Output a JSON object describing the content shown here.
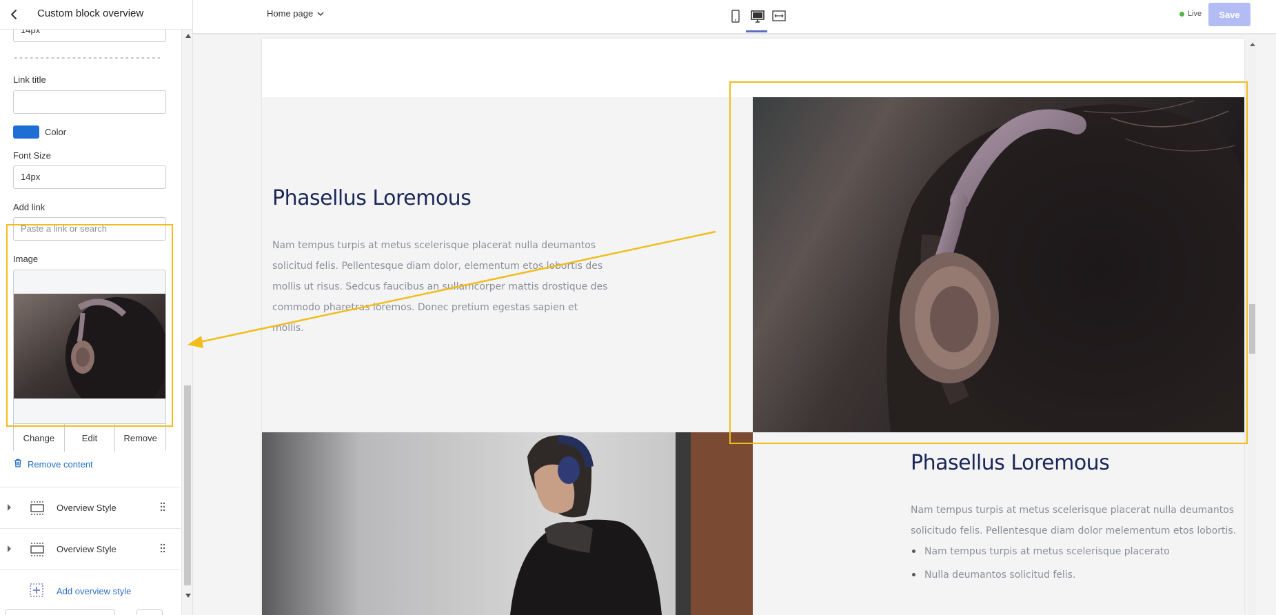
{
  "sidebar": {
    "title": "Custom block overview",
    "top_field_value": "14px",
    "separator": "----------------------------",
    "link_title_label": "Link title",
    "link_title_value": "",
    "color_label": "Color",
    "color_value": "#1d6fd6",
    "font_size_label": "Font Size",
    "font_size_value": "14px",
    "add_link_label": "Add link",
    "add_link_placeholder": "Paste a link or search",
    "image_label": "Image",
    "image_actions": {
      "change": "Change",
      "edit": "Edit",
      "remove": "Remove"
    },
    "remove_content": "Remove content",
    "overview_items": [
      {
        "label": "Overview Style"
      },
      {
        "label": "Overview Style"
      }
    ],
    "add_overview": "Add overview style"
  },
  "topbar": {
    "page_select": "Home page",
    "devices": [
      "mobile-icon",
      "desktop-icon",
      "full-width-icon"
    ],
    "active_device": "desktop-icon",
    "live_label": "Live",
    "save_label": "Save"
  },
  "preview": {
    "section1": {
      "heading": "Phasellus Loremous",
      "body_lines": [
        "Nam tempus turpis at metus scelerisque placerat nulla deumantos",
        "solicitud felis. Pellentesque diam dolor, elementum etos lobortis des",
        "mollis ut risus. Sedcus faucibus an sullamcorper mattis drostique des",
        "commodo pharetras loremos. Donec pretium egestas sapien et",
        "mollis."
      ]
    },
    "section2": {
      "heading": "Phasellus Loremous",
      "body_lines": [
        "Nam tempus turpis at metus scelerisque placerat nulla deumantos",
        "solicitudo felis. Pellentesque diam dolor melementum etos lobortis."
      ],
      "bullets": [
        "Nam tempus turpis at metus scelerisque placerato",
        "Nulla deumantos solicitud felis."
      ]
    }
  },
  "colors": {
    "highlight": "#f0bd1c",
    "accent": "#5c6ac4",
    "heading": "#1b2757",
    "link": "#1f6fc5",
    "live_dot": "#50b83c"
  }
}
